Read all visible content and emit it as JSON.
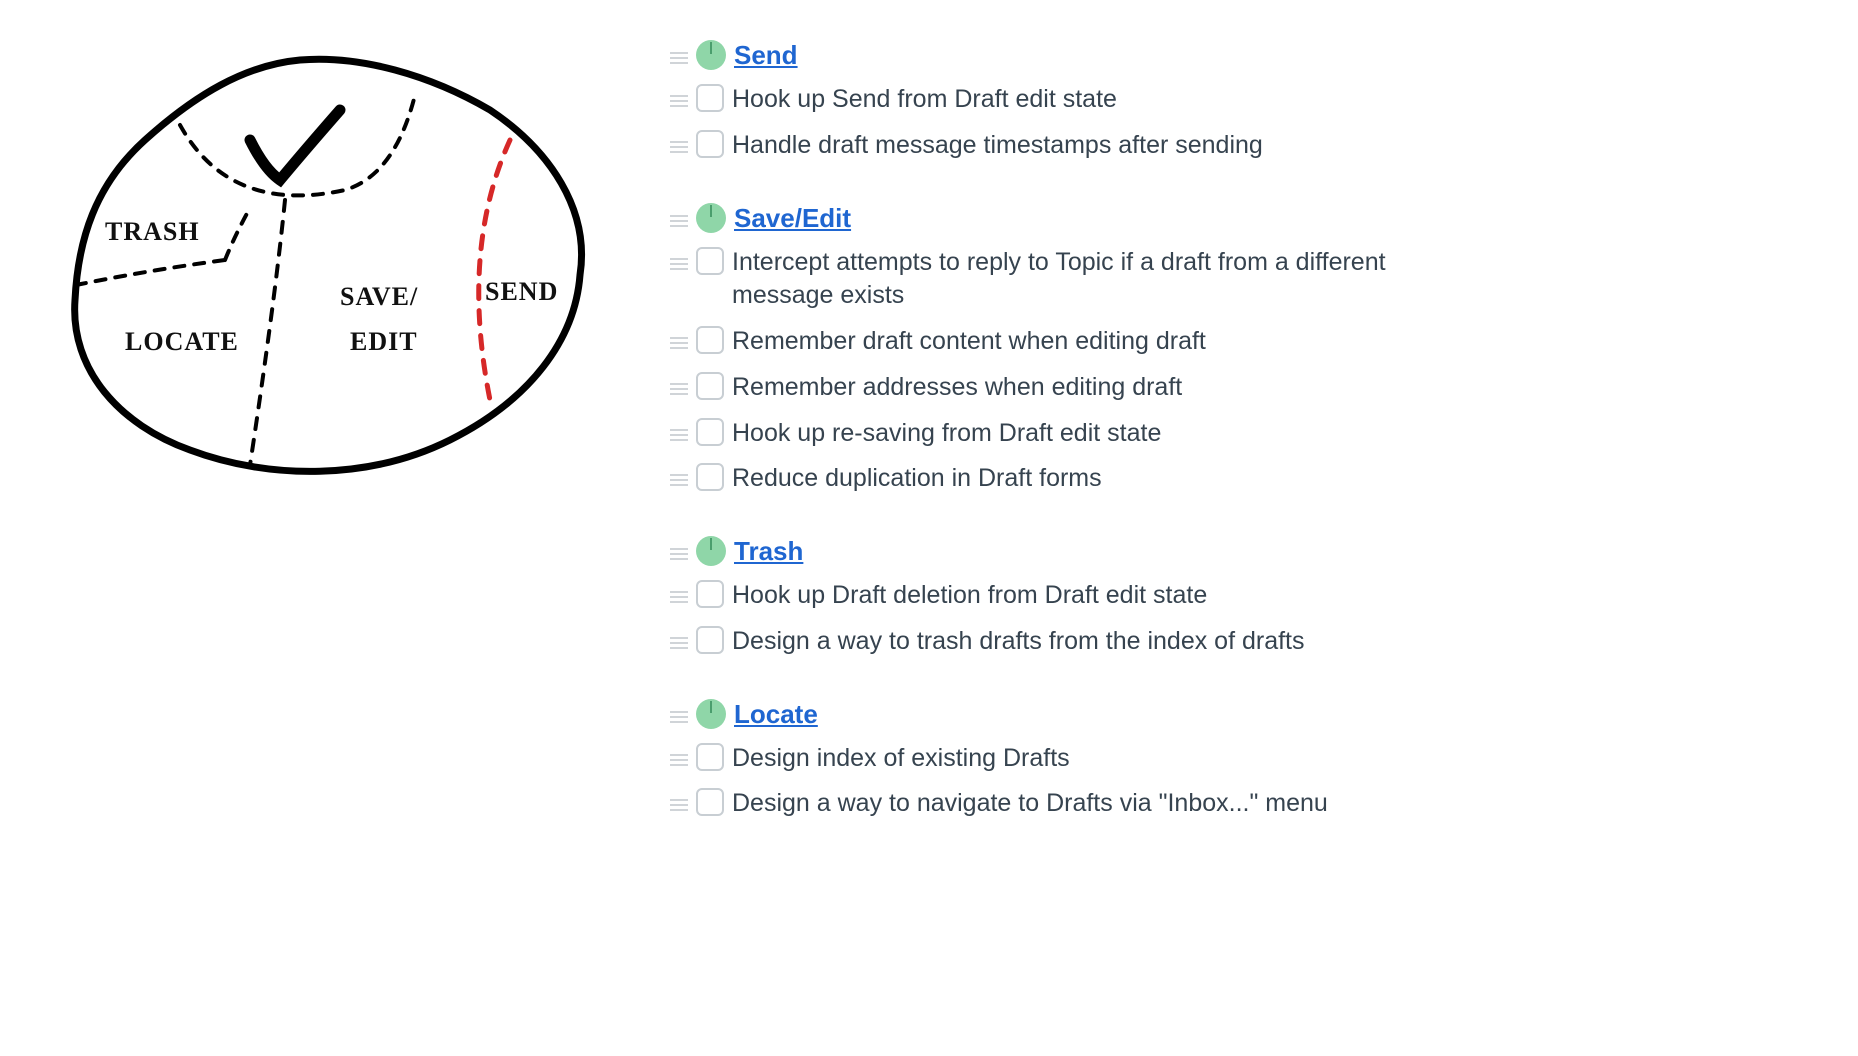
{
  "sketch": {
    "labels": {
      "trash": "TRASH",
      "locate": "LOCATE",
      "save_edit_line1": "SAVE/",
      "save_edit_line2": "EDIT",
      "send": "SEND"
    }
  },
  "groups": [
    {
      "heading": "Send",
      "tasks": [
        "Hook up Send from Draft edit state",
        "Handle draft message timestamps after sending"
      ]
    },
    {
      "heading": "Save/Edit",
      "tasks": [
        "Intercept attempts to reply to Topic if a draft from a different message exists",
        "Remember draft content when editing draft",
        "Remember addresses when editing draft",
        "Hook up re-saving from Draft edit state",
        "Reduce duplication in Draft forms"
      ]
    },
    {
      "heading": "Trash",
      "tasks": [
        "Hook up Draft deletion from Draft edit state",
        "Design a way to trash drafts from the index of drafts"
      ]
    },
    {
      "heading": "Locate",
      "tasks": [
        "Design index of existing Drafts",
        "Design a way to navigate to Drafts via \"Inbox...\" menu"
      ]
    }
  ]
}
